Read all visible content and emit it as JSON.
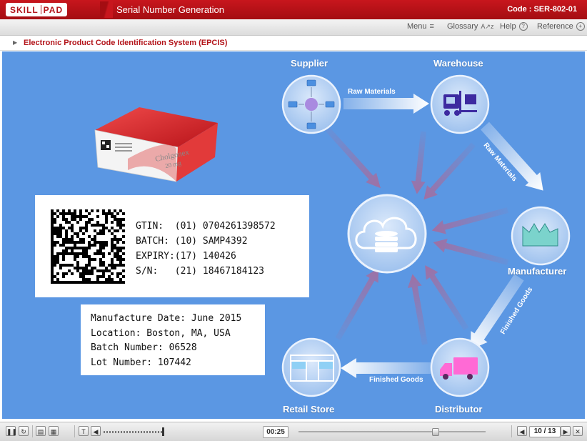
{
  "app": {
    "logo_left": "SKILL",
    "logo_right": "PAD",
    "module_title": "Serial Number Generation",
    "code": "Code : SER-802-01"
  },
  "menubar": {
    "menu": "Menu",
    "glossary": "Glossary",
    "help": "Help",
    "reference": "Reference"
  },
  "breadcrumb": "Electronic Product Code Identification System (EPCIS)",
  "product_box": {
    "brand": "Cholgonex",
    "dose": "20 mg"
  },
  "barcode_card": {
    "lines": [
      "GTIN:  (01) 0704261398572",
      "BATCH: (10) SAMP4392",
      "EXPIRY:(17) 140426",
      "S/N:   (21) 18467184123"
    ]
  },
  "info_card": {
    "lines": [
      "Manufacture Date: June 2015",
      "Location: Boston, MA, USA",
      "Batch Number: 06528",
      "Lot Number: 107442"
    ]
  },
  "diagram": {
    "nodes": {
      "supplier": "Supplier",
      "warehouse": "Warehouse",
      "manufacturer": "Manufacturer",
      "distributor": "Distributor",
      "retail": "Retail Store"
    },
    "flows": {
      "supplier_warehouse": "Raw Materials",
      "warehouse_manufacturer": "Raw Materials",
      "manufacturer_distributor": "Finished Goods",
      "distributor_retail": "Finished Goods"
    },
    "colors": {
      "background": "#5b97e3",
      "node_fill": "#b7d2f3",
      "spoke": "#a36ea0"
    }
  },
  "player": {
    "time": "00:25",
    "page": "10 / 13",
    "progress": 0.73
  }
}
